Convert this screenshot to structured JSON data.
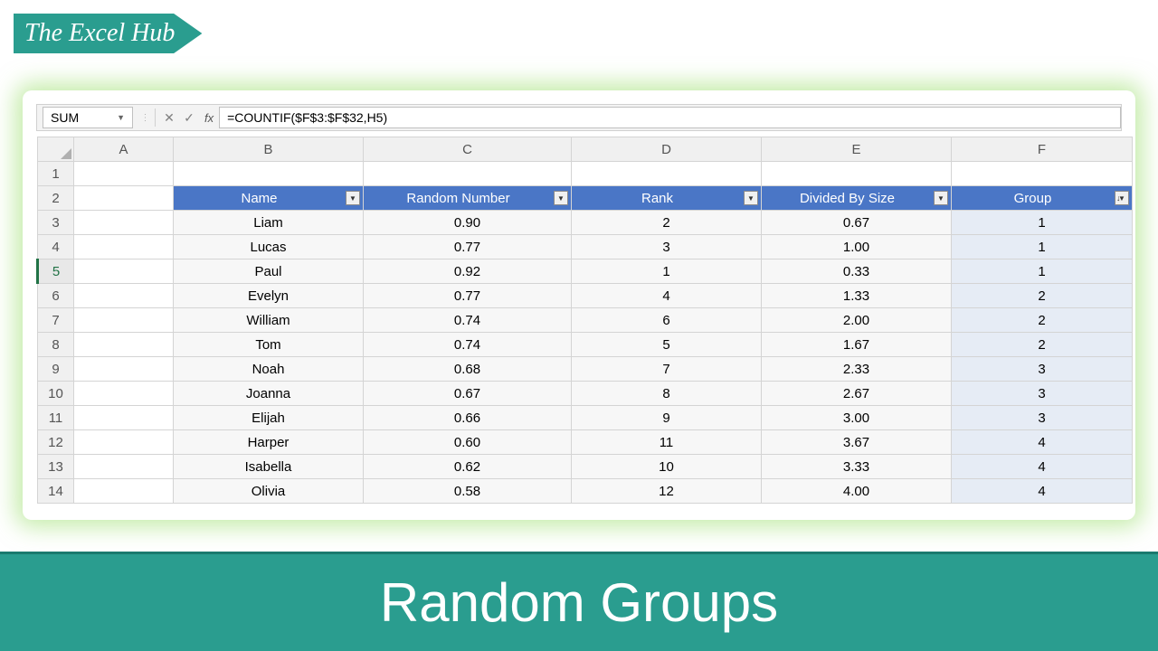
{
  "logo": "The Excel Hub",
  "footer_title": "Random Groups",
  "formula_bar": {
    "name_box": "SUM",
    "fx_label": "fx",
    "formula": "=COUNTIF($F$3:$F$32,H5)"
  },
  "columns": [
    "A",
    "B",
    "C",
    "D",
    "E",
    "F"
  ],
  "active_row": "5",
  "table": {
    "headers": [
      "Name",
      "Random Number",
      "Rank",
      "Divided By Size",
      "Group"
    ],
    "rows": [
      {
        "n": "3",
        "name": "Liam",
        "rand": "0.90",
        "rank": "2",
        "div": "0.67",
        "group": "1"
      },
      {
        "n": "4",
        "name": "Lucas",
        "rand": "0.77",
        "rank": "3",
        "div": "1.00",
        "group": "1"
      },
      {
        "n": "5",
        "name": "Paul",
        "rand": "0.92",
        "rank": "1",
        "div": "0.33",
        "group": "1"
      },
      {
        "n": "6",
        "name": "Evelyn",
        "rand": "0.77",
        "rank": "4",
        "div": "1.33",
        "group": "2"
      },
      {
        "n": "7",
        "name": "William",
        "rand": "0.74",
        "rank": "6",
        "div": "2.00",
        "group": "2"
      },
      {
        "n": "8",
        "name": "Tom",
        "rand": "0.74",
        "rank": "5",
        "div": "1.67",
        "group": "2"
      },
      {
        "n": "9",
        "name": "Noah",
        "rand": "0.68",
        "rank": "7",
        "div": "2.33",
        "group": "3"
      },
      {
        "n": "10",
        "name": "Joanna",
        "rand": "0.67",
        "rank": "8",
        "div": "2.67",
        "group": "3"
      },
      {
        "n": "11",
        "name": "Elijah",
        "rand": "0.66",
        "rank": "9",
        "div": "3.00",
        "group": "3"
      },
      {
        "n": "12",
        "name": "Harper",
        "rand": "0.60",
        "rank": "11",
        "div": "3.67",
        "group": "4"
      },
      {
        "n": "13",
        "name": "Isabella",
        "rand": "0.62",
        "rank": "10",
        "div": "3.33",
        "group": "4"
      },
      {
        "n": "14",
        "name": "Olivia",
        "rand": "0.58",
        "rank": "12",
        "div": "4.00",
        "group": "4"
      }
    ]
  }
}
